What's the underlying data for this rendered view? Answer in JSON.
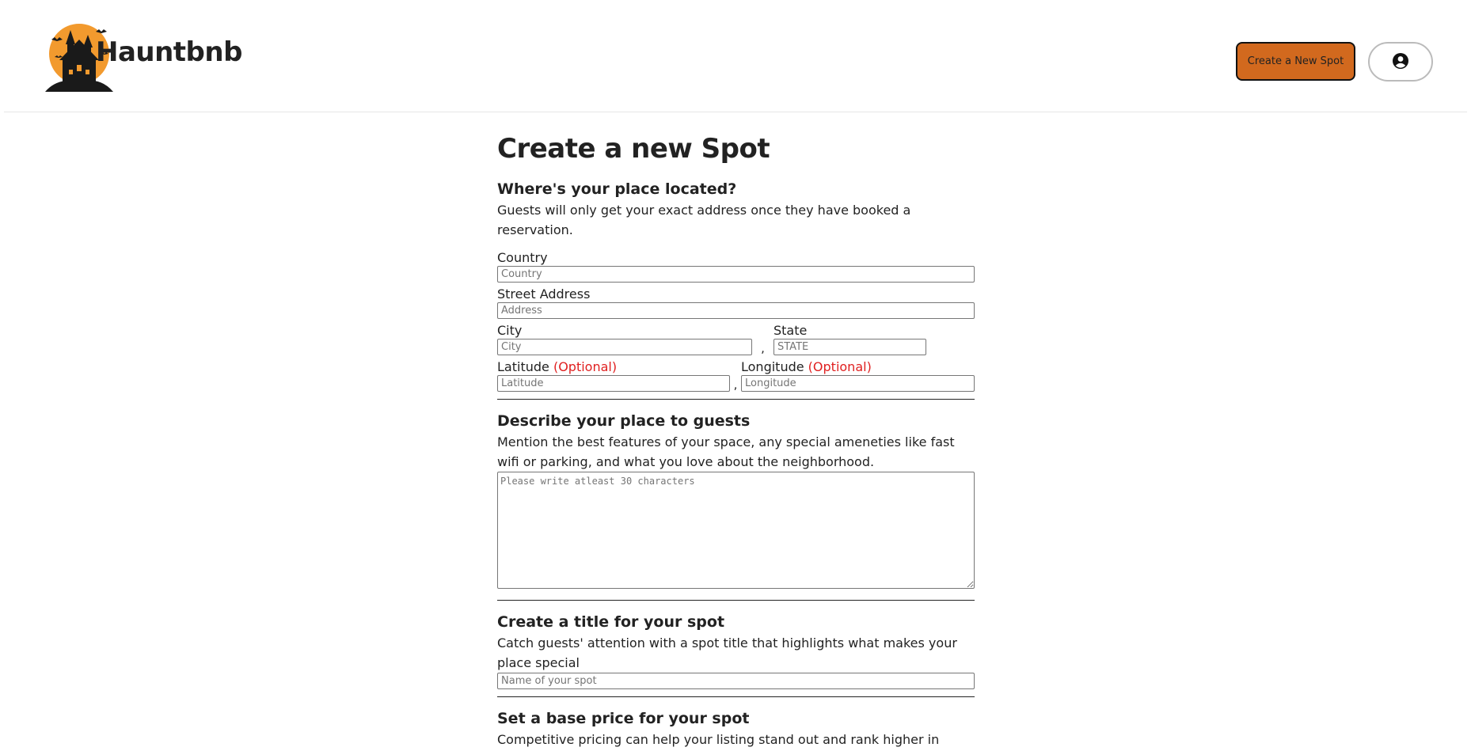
{
  "header": {
    "brand": "Hauntbnb",
    "logo_icon": "haunted-house-moon-icon",
    "create_spot_label": "Create a New Spot",
    "profile_icon": "user-circle-icon",
    "accent_color": "#d2691e"
  },
  "form": {
    "title": "Create a new Spot",
    "location": {
      "heading": "Where's your place located?",
      "description": "Guests will only get your exact address once they have booked a reservation.",
      "country": {
        "label": "Country",
        "placeholder": "Country"
      },
      "street": {
        "label": "Street Address",
        "placeholder": "Address"
      },
      "city": {
        "label": "City",
        "placeholder": "City"
      },
      "state": {
        "label": "State",
        "placeholder": "STATE"
      },
      "latitude": {
        "label": "Latitude",
        "optional": "(Optional)",
        "placeholder": "Latitude"
      },
      "longitude": {
        "label": "Longitude",
        "optional": "(Optional)",
        "placeholder": "Longitude"
      },
      "separator": ","
    },
    "description": {
      "heading": "Describe your place to guests",
      "description": "Mention the best features of your space, any special ameneties like fast wifi or parking, and what you love about the neighborhood.",
      "placeholder": "Please write atleast 30 characters"
    },
    "title_section": {
      "heading": "Create a title for your spot",
      "description": "Catch guests' attention with a spot title that highlights what makes your place special",
      "placeholder": "Name of your spot"
    },
    "price": {
      "heading": "Set a base price for your spot",
      "description": "Competitive pricing can help your listing stand out and rank higher in"
    }
  }
}
